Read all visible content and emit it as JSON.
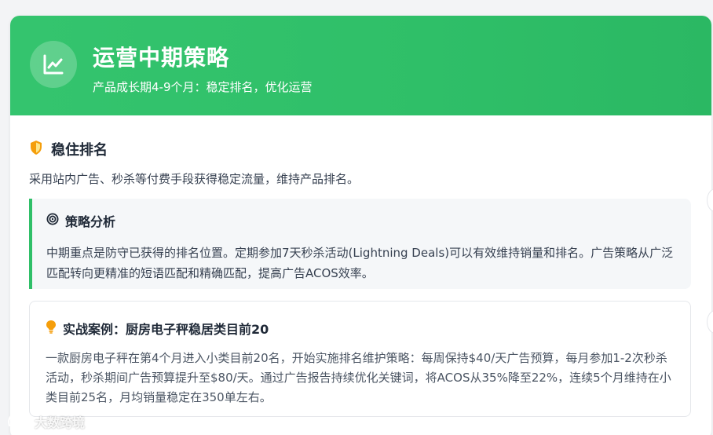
{
  "header": {
    "title": "运营中期策略",
    "subtitle": "产品成长期4-9个月：稳定排名，优化运营"
  },
  "section": {
    "title": "稳住排名",
    "description": "采用站内广告、秒杀等付费手段获得稳定流量，维持产品排名。"
  },
  "analysis": {
    "title": "策略分析",
    "body": "中期重点是防守已获得的排名位置。定期参加7天秒杀活动(Lightning Deals)可以有效维持销量和排名。广告策略从广泛匹配转向更精准的短语匹配和精确匹配，提高广告ACOS效率。"
  },
  "case": {
    "title": "实战案例：厨房电子秤稳居类目前20",
    "body": "一款厨房电子秤在第4个月进入小类目前20名，开始实施排名维护策略：每周保持$40/天广告预算，每月参加1-2次秒杀活动，秒杀期间广告预算提升至$80/天。通过广告报告持续优化关键词，将ACOS从35%降至22%，连续5个月维持在小类目前25名，月均销量稳定在350单左右。"
  },
  "watermark": {
    "text": "大数跨境"
  },
  "icons": {
    "header": "chart-line-icon",
    "section": "shield-icon",
    "analysis": "target-icon",
    "case": "lightbulb-icon"
  },
  "colors": {
    "accent": "#2fbf68",
    "shield": "#f59e0b",
    "bulb": "#f59e0b"
  }
}
